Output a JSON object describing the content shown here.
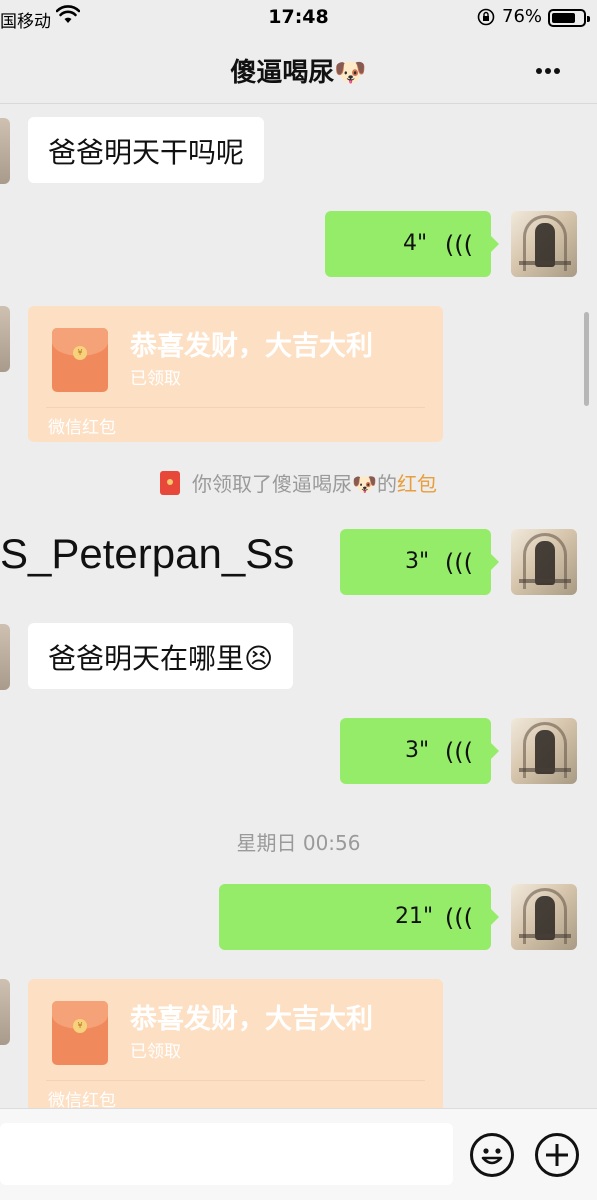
{
  "status_bar": {
    "carrier": "国移动",
    "time": "17:48",
    "battery": "76%",
    "battery_level": 0.76
  },
  "nav": {
    "title": "傻逼喝尿🐶",
    "more_icon": "more-dots-icon"
  },
  "messages": [
    {
      "side": "left",
      "type": "text",
      "text": "爸爸明天干吗呢"
    },
    {
      "side": "right",
      "type": "voice",
      "duration": "4\""
    },
    {
      "side": "left",
      "type": "red_packet",
      "title": "恭喜发财，大吉大利",
      "status": "已领取",
      "footer": "微信红包"
    },
    {
      "type": "system",
      "prefix": "你领取了傻逼喝尿🐶的",
      "link": "红包"
    },
    {
      "side": "right",
      "type": "voice",
      "duration": "3\""
    },
    {
      "side": "left",
      "type": "text",
      "text": "爸爸明天在哪里😣"
    },
    {
      "side": "right",
      "type": "voice",
      "duration": "3\""
    },
    {
      "type": "timestamp",
      "text": "星期日 00:56"
    },
    {
      "side": "right",
      "type": "voice",
      "duration": "21\""
    },
    {
      "side": "left",
      "type": "red_packet",
      "title": "恭喜发财，大吉大利",
      "status": "已领取",
      "footer": "微信红包"
    }
  ],
  "overlay_text": "S_Peterpan_Ss",
  "input_bar": {
    "placeholder": "",
    "emoji_icon": "emoji-icon",
    "add_icon": "plus-icon"
  },
  "colors": {
    "background": "#ededed",
    "voice_bubble": "#95ec69",
    "red_packet": "#fde0c4",
    "link": "#e89e3c"
  }
}
